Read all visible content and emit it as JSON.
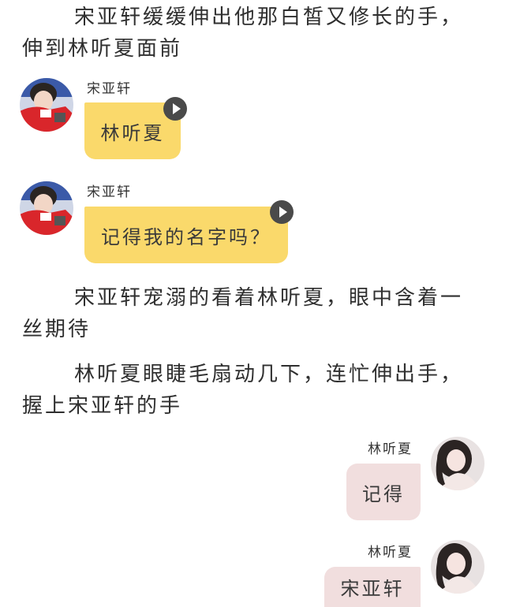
{
  "narration": [
    "宋亚轩缓缓伸出他那白皙又修长的手，伸到林听夏面前",
    "宋亚轩宠溺的看着林听夏，眼中含着一丝期待",
    "林听夏眼睫毛扇动几下，连忙伸出手，握上宋亚轩的手"
  ],
  "messages": [
    {
      "speaker": "宋亚轩",
      "text": "林听夏",
      "side": "left"
    },
    {
      "speaker": "宋亚轩",
      "text": "记得我的名字吗？",
      "side": "left"
    },
    {
      "speaker": "林听夏",
      "text": "记得",
      "side": "right"
    },
    {
      "speaker": "林听夏",
      "text": "宋亚轩",
      "side": "right"
    }
  ],
  "icons": {
    "play": "play-icon",
    "avatar_left": "male-avatar-red-shirt",
    "avatar_right": "female-avatar-dark-hair"
  },
  "colors": {
    "left_bubble": "#fad96b",
    "right_bubble": "#f1dede",
    "play_button": "#4a4a4a"
  }
}
